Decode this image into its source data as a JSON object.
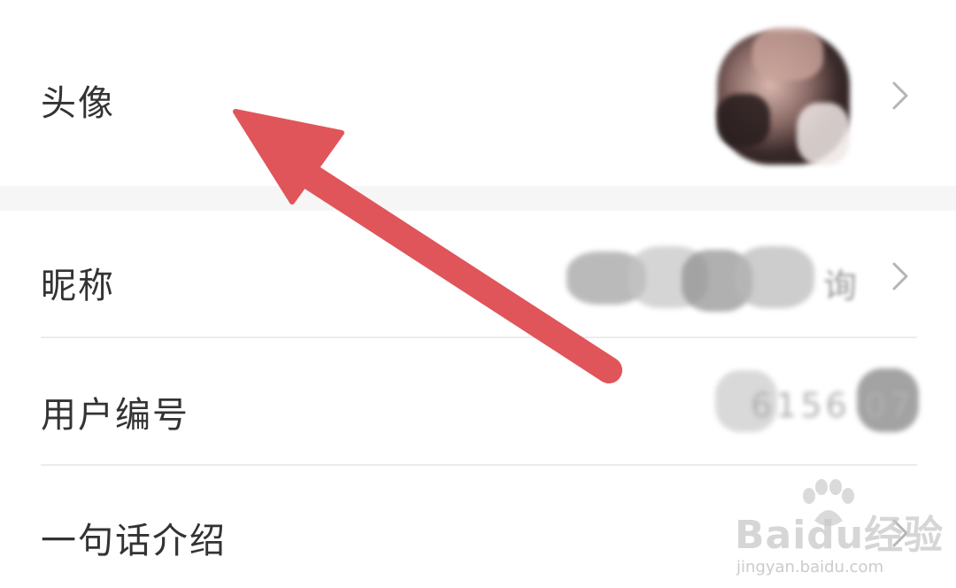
{
  "rows": [
    {
      "id": "avatar",
      "label": "头像"
    },
    {
      "id": "nickname",
      "label": "昵称",
      "value_hint": "询"
    },
    {
      "id": "user-id",
      "label": "用户编号",
      "value_hint": "6156 07"
    },
    {
      "id": "intro",
      "label": "一句话介绍"
    }
  ],
  "watermark": {
    "logo": "Baidu经验",
    "url": "jingyan.baidu.com"
  },
  "colors": {
    "arrow": "#e0555a",
    "text": "#333333",
    "chevron": "#b5b5b5",
    "divider": "#ececec",
    "section_gap": "#f6f6f6"
  },
  "icons": {
    "chevron": "chevron-right-icon",
    "annotation": "arrow-annotation-icon"
  }
}
